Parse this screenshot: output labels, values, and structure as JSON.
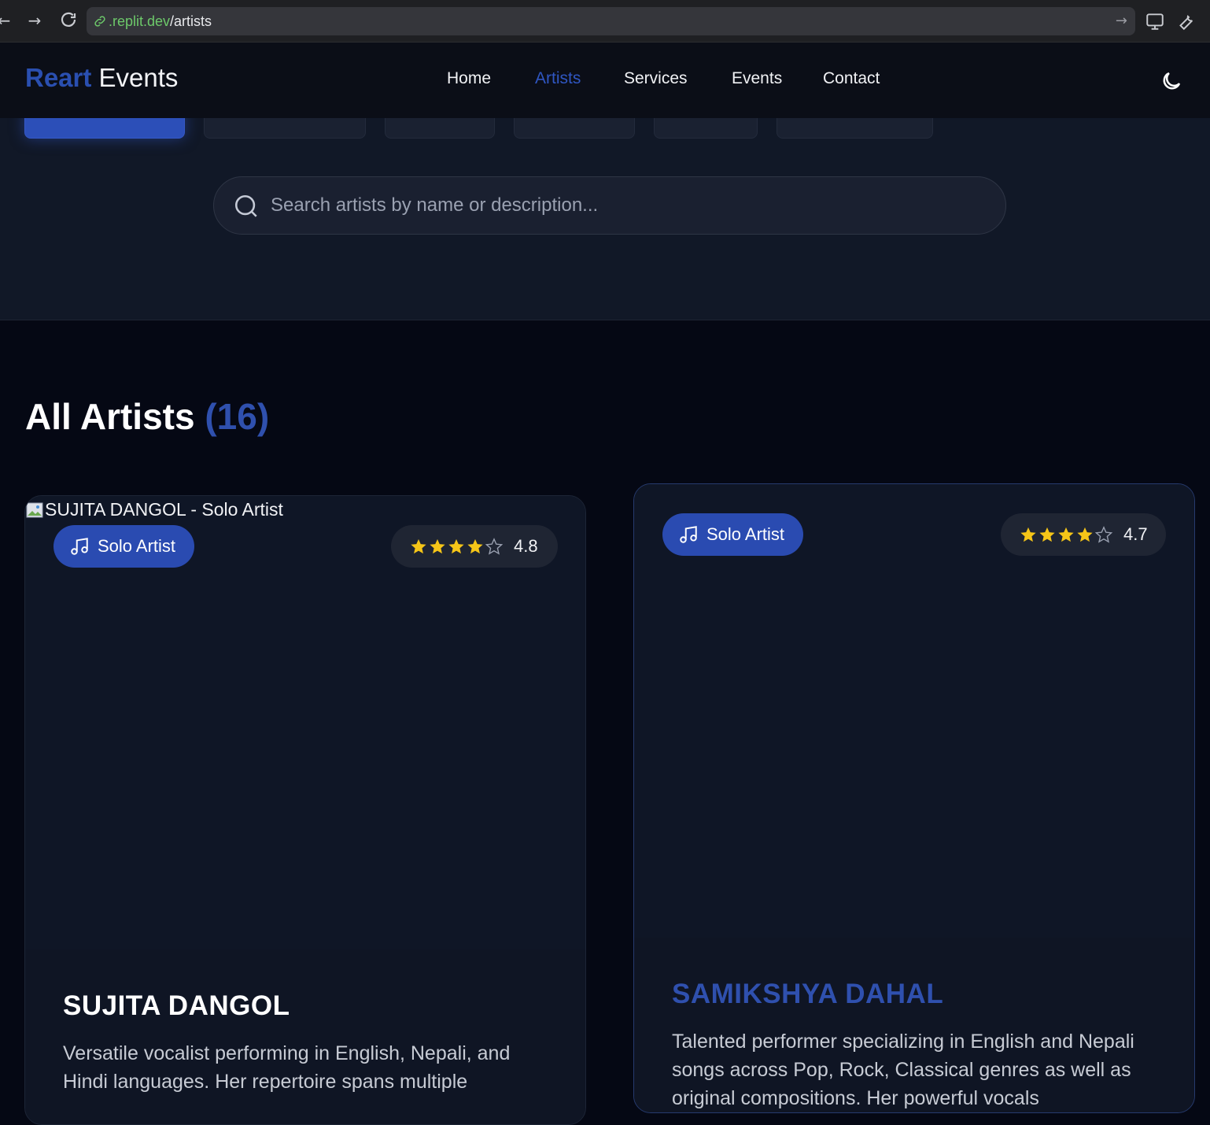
{
  "browser": {
    "url_host": ".replit.dev",
    "url_path": "/artists"
  },
  "header": {
    "logo_brand": "Reart",
    "logo_rest": "Events",
    "nav": {
      "home": "Home",
      "artists": "Artists",
      "services": "Services",
      "events": "Events",
      "contact": "Contact"
    }
  },
  "search": {
    "placeholder": "Search artists by name or description..."
  },
  "artists_section": {
    "title": "All Artists",
    "count": "(16)"
  },
  "artists": [
    {
      "image_alt": "SUJITA DANGOL - Solo Artist",
      "type": "Solo Artist",
      "rating": "4.8",
      "name": "SUJITA DANGOL",
      "description": "Versatile vocalist performing in English, Nepali, and Hindi languages. Her repertoire spans multiple"
    },
    {
      "type": "Solo Artist",
      "rating": "4.7",
      "name": "SAMIKSHYA DAHAL",
      "description": "Talented performer specializing in English and Nepali songs across Pop, Rock, Classical genres as well as original compositions. Her powerful vocals"
    }
  ],
  "colors": {
    "accent": "#2a4fb0",
    "star": "#f5c518",
    "background": "#050814"
  }
}
